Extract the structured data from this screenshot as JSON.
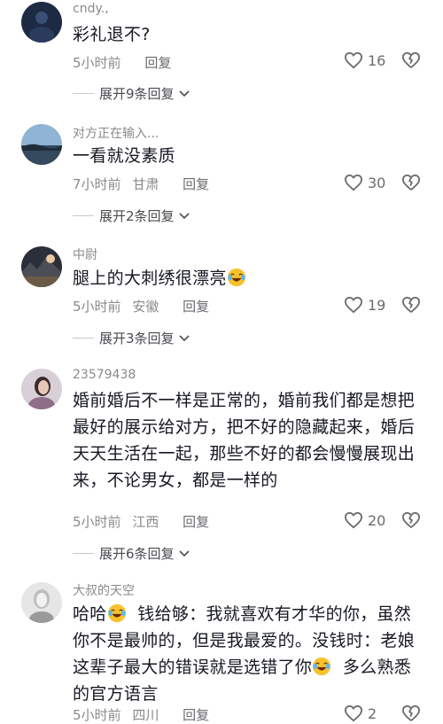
{
  "comments": [
    {
      "username": "cndy.,",
      "text": "彩礼退不?",
      "time": "5小时前",
      "location": "",
      "reply_label": "回复",
      "likes": "16",
      "expand_label": "展开9条回复"
    },
    {
      "username": "对方正在输入...",
      "text": "一看就没素质",
      "time": "7小时前",
      "location": "甘肃",
      "reply_label": "回复",
      "likes": "30",
      "expand_label": "展开2条回复"
    },
    {
      "username": "中尉",
      "text": "腿上的大刺绣很漂亮",
      "time": "5小时前",
      "location": "安徽",
      "reply_label": "回复",
      "likes": "19",
      "expand_label": "展开3条回复"
    },
    {
      "username": "23579438",
      "text": "婚前婚后不一样是正常的，婚前我们都是想把最好的展示给对方，把不好的隐藏起来，婚后天天生活在一起，那些不好的都会慢慢展现出来，不论男女，都是一样的",
      "time": "5小时前",
      "location": "江西",
      "reply_label": "回复",
      "likes": "20",
      "expand_label": "展开6条回复"
    },
    {
      "username": "大叔的天空",
      "text_parts": [
        "哈哈",
        "钱给够：我就喜欢有才华的你，虽然你不是最帅的，但是我最爱的。没钱时：老娘这辈子最大的错误就是选错了你",
        "多么熟悉的官方语言"
      ],
      "time": "5小时前",
      "location": "四川",
      "reply_label": "回复",
      "likes": "2"
    }
  ],
  "icons": {
    "like": "heart-outline-icon",
    "dislike": "broken-heart-icon",
    "expand": "chevron-down-icon",
    "emoji": "laughing-tears-emoji"
  },
  "colors": {
    "text": "#161823",
    "secondary": "#8a8a8f",
    "divider": "#c9c9cc"
  }
}
